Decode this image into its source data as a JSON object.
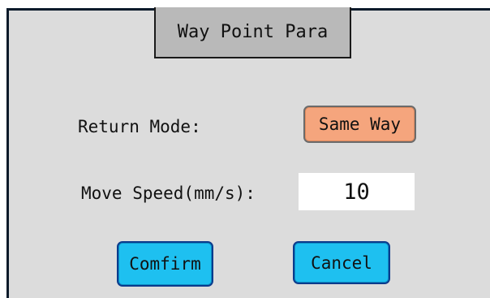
{
  "dialog": {
    "title": "Way Point Para"
  },
  "return_mode": {
    "label": "Return Mode:",
    "value": "Same Way"
  },
  "move_speed": {
    "label": "Move Speed(mm/s):",
    "value": "10"
  },
  "actions": {
    "confirm_label": "Comfirm",
    "cancel_label": "Cancel"
  },
  "colors": {
    "panel_background": "#dcdcdc",
    "title_background": "#b9b9b9",
    "mode_button": "#f5a57d",
    "action_button": "#1ec0f0"
  }
}
